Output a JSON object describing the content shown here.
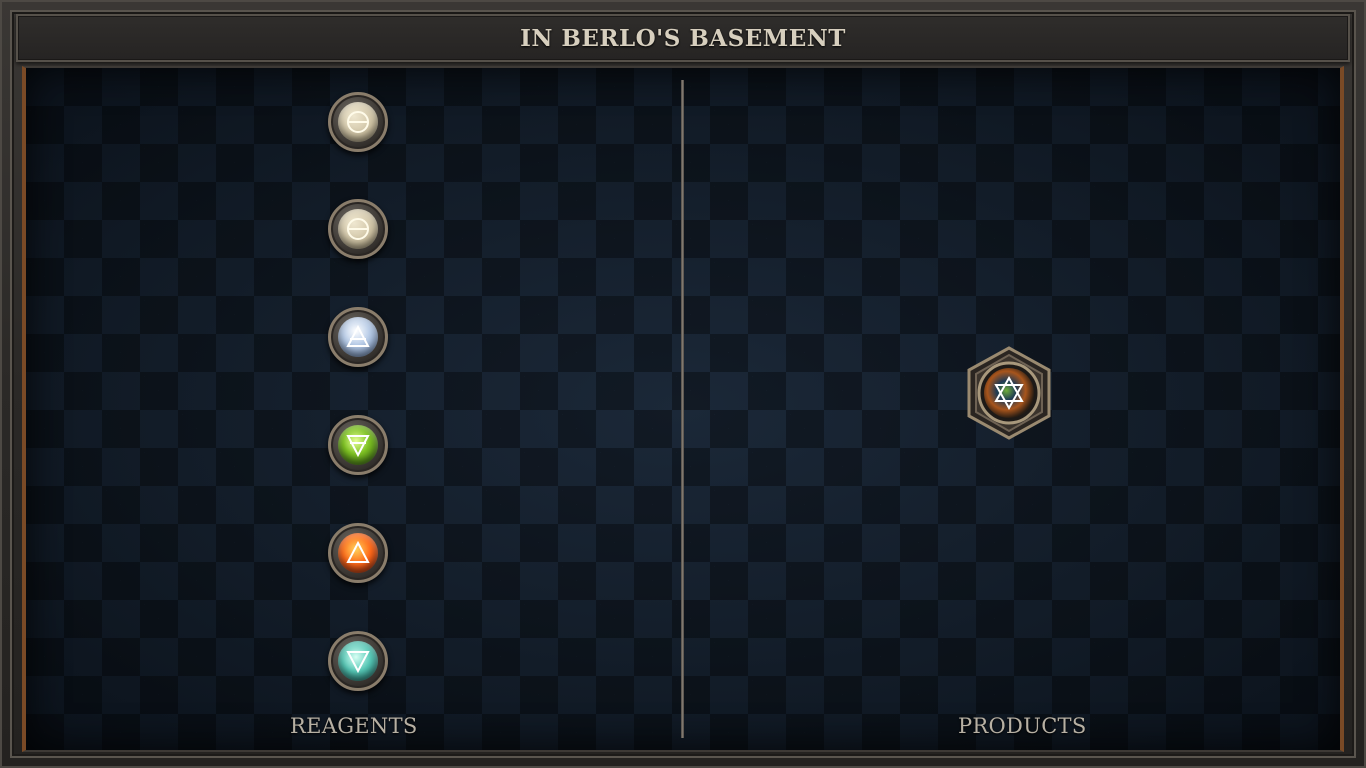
{
  "header": {
    "title": "IN BERLO'S BASEMENT"
  },
  "reagents": {
    "label": "REAGENTS",
    "items": [
      {
        "name": "salt",
        "icon": "salt-icon"
      },
      {
        "name": "salt",
        "icon": "salt-icon"
      },
      {
        "name": "air",
        "icon": "air-icon"
      },
      {
        "name": "earth",
        "icon": "earth-icon"
      },
      {
        "name": "fire",
        "icon": "fire-icon"
      },
      {
        "name": "water",
        "icon": "water-icon"
      }
    ]
  },
  "products": {
    "label": "PRODUCTS",
    "items": [
      {
        "name": "vitae",
        "icon": "hexagram-icon"
      }
    ]
  },
  "colors": {
    "board": "#131d29",
    "frame": "#2a2826",
    "accent_copper": "#7a4a26",
    "label_text": "#b7b0a3",
    "title_text": "#d7cfbe"
  }
}
